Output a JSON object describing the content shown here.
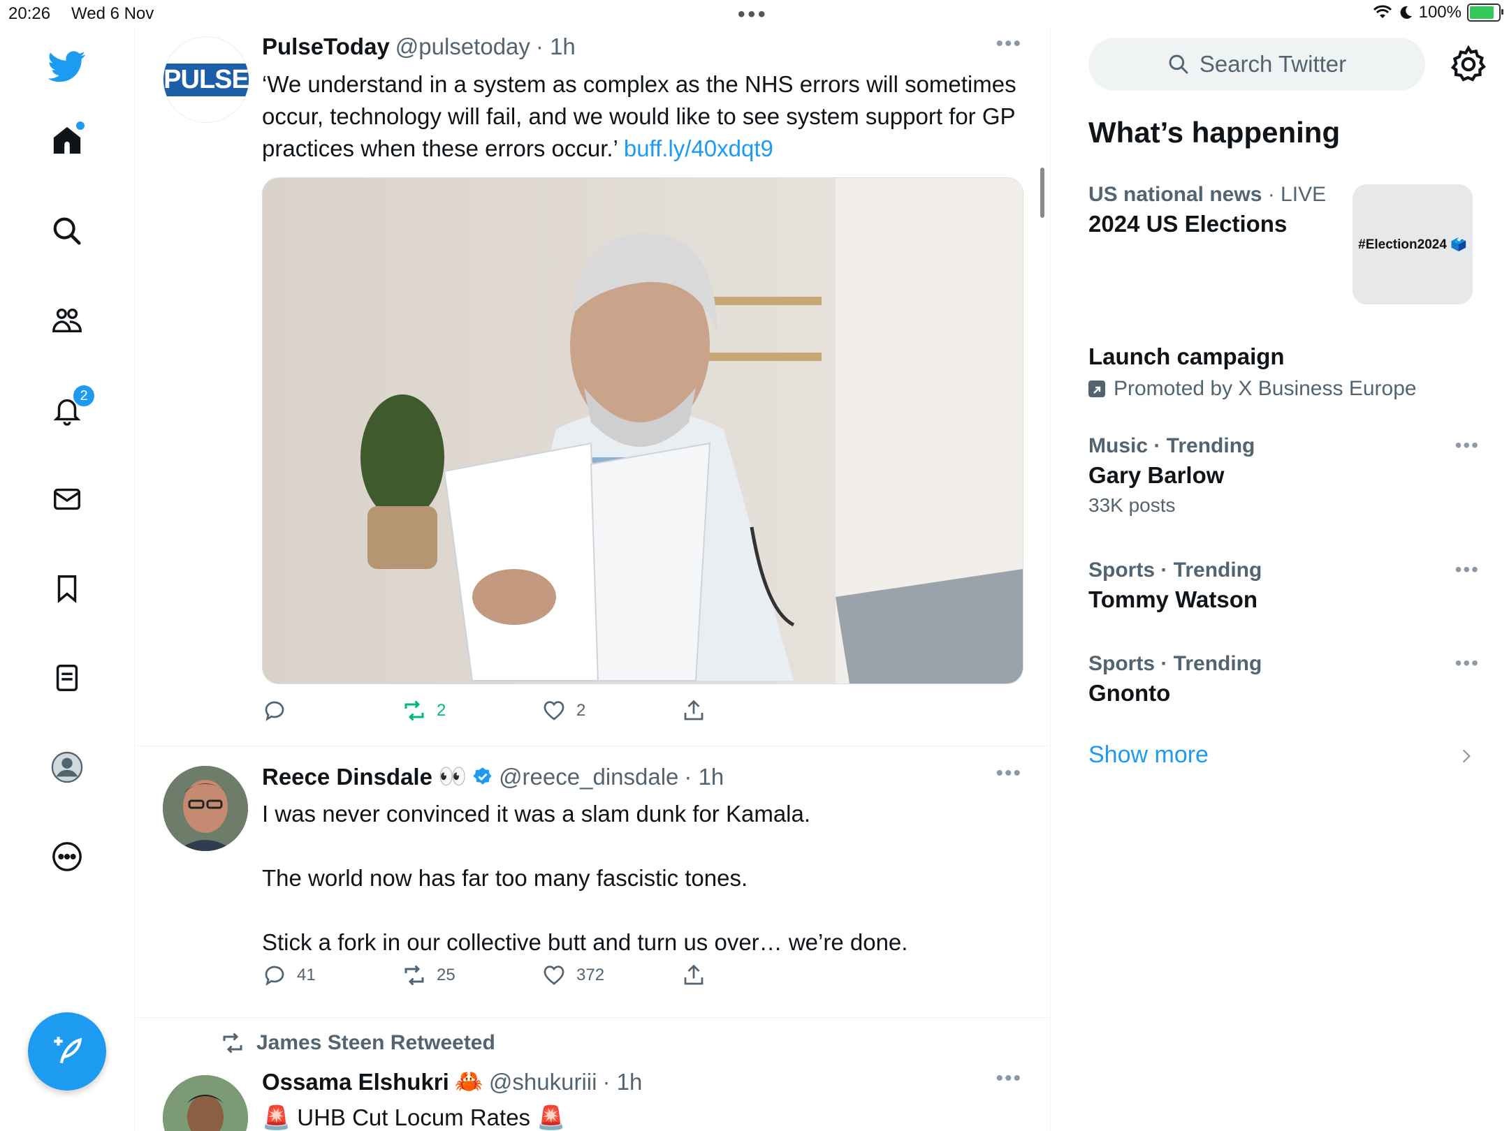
{
  "status_bar": {
    "time": "20:26",
    "date": "Wed 6 Nov",
    "battery": "100%"
  },
  "nav": {
    "notifications_badge": "2"
  },
  "tweets": [
    {
      "name": "PulseToday",
      "handle": "@pulsetoday",
      "time": "· 1h",
      "avatar_text": "PULSE",
      "text": "‘We understand in a system as complex as the NHS errors will sometimes occur, technology will fail, and we would like to see system support for GP practices when these errors occur.’ ",
      "link": "buff.ly/40xdqt9",
      "replies": "",
      "retweets": "2",
      "likes": "2"
    },
    {
      "name": "Reece Dinsdale",
      "emoji": "👀",
      "handle": "@reece_dinsdale",
      "time": "· 1h",
      "line1": "I was never convinced it was a slam dunk for Kamala.",
      "line2": "The world now has far too many fascistic tones.",
      "line3": "Stick a fork in our collective butt and turn us over… we’re done.",
      "replies": "41",
      "retweets": "25",
      "likes": "372"
    },
    {
      "retweeted_by": "James Steen Retweeted",
      "name": "Ossama Elshukri",
      "emoji": "🦀",
      "handle": "@shukuriii",
      "time": "· 1h",
      "text": "🚨 UHB Cut Locum Rates 🚨"
    }
  ],
  "right": {
    "search_placeholder": "Search Twitter",
    "title": "What’s happening",
    "trends": [
      {
        "meta": "US national news",
        "live": " · LIVE",
        "topic": "2024 US Elections",
        "thumb": "#Election2024 🗳️"
      },
      {
        "topic": "Launch campaign",
        "promo": "Promoted by X Business Europe"
      },
      {
        "meta": "Music · Trending",
        "topic": "Gary Barlow",
        "count": "33K posts"
      },
      {
        "meta": "Sports · Trending",
        "topic": "Tommy Watson"
      },
      {
        "meta": "Sports · Trending",
        "topic": "Gnonto"
      }
    ],
    "show_more": "Show more"
  },
  "colors": {
    "accent": "#1d9bf0",
    "retweet": "#00ba7c",
    "secondary": "#536471"
  }
}
